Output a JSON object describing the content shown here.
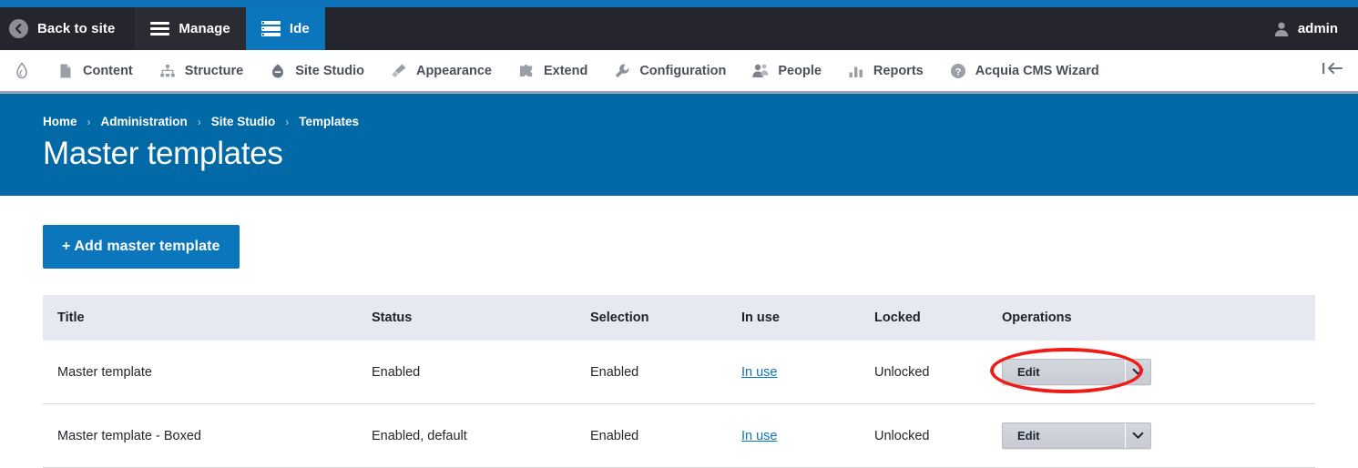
{
  "colors": {
    "top_strip": "#0c72ba",
    "toolbar_bg": "#25252d",
    "active_tab": "#0c76bd",
    "banner": "#0069a6",
    "primary_button": "#0c76bd",
    "link": "#0c76bd",
    "table_header": "#e6e8f2",
    "annotation": "#ee1c18"
  },
  "toolbar": {
    "back_to_site": "Back to site",
    "manage": "Manage",
    "ide": "Ide",
    "user": "admin"
  },
  "menu": {
    "items": [
      {
        "label": "Content",
        "icon": "page-icon"
      },
      {
        "label": "Structure",
        "icon": "sitemap-icon"
      },
      {
        "label": "Site Studio",
        "icon": "sitestudio-icon"
      },
      {
        "label": "Appearance",
        "icon": "brush-icon"
      },
      {
        "label": "Extend",
        "icon": "puzzle-icon"
      },
      {
        "label": "Configuration",
        "icon": "wrench-icon"
      },
      {
        "label": "People",
        "icon": "people-icon"
      },
      {
        "label": "Reports",
        "icon": "bars-icon"
      },
      {
        "label": "Acquia CMS Wizard",
        "icon": "question-circle-icon"
      }
    ]
  },
  "banner": {
    "breadcrumb": [
      {
        "label": "Home"
      },
      {
        "label": "Administration"
      },
      {
        "label": "Site Studio"
      },
      {
        "label": "Templates"
      }
    ],
    "separator": "›",
    "title": "Master templates"
  },
  "actions": {
    "add_master_template": "+ Add master template"
  },
  "table": {
    "columns": [
      "Title",
      "Status",
      "Selection",
      "In use",
      "Locked",
      "Operations"
    ],
    "rows": [
      {
        "title": "Master template",
        "status": "Enabled",
        "selection": "Enabled",
        "in_use": "In use",
        "locked": "Unlocked",
        "operation": "Edit",
        "highlighted": true
      },
      {
        "title": "Master template - Boxed",
        "status": "Enabled, default",
        "selection": "Enabled",
        "in_use": "In use",
        "locked": "Unlocked",
        "operation": "Edit",
        "highlighted": false
      }
    ]
  }
}
